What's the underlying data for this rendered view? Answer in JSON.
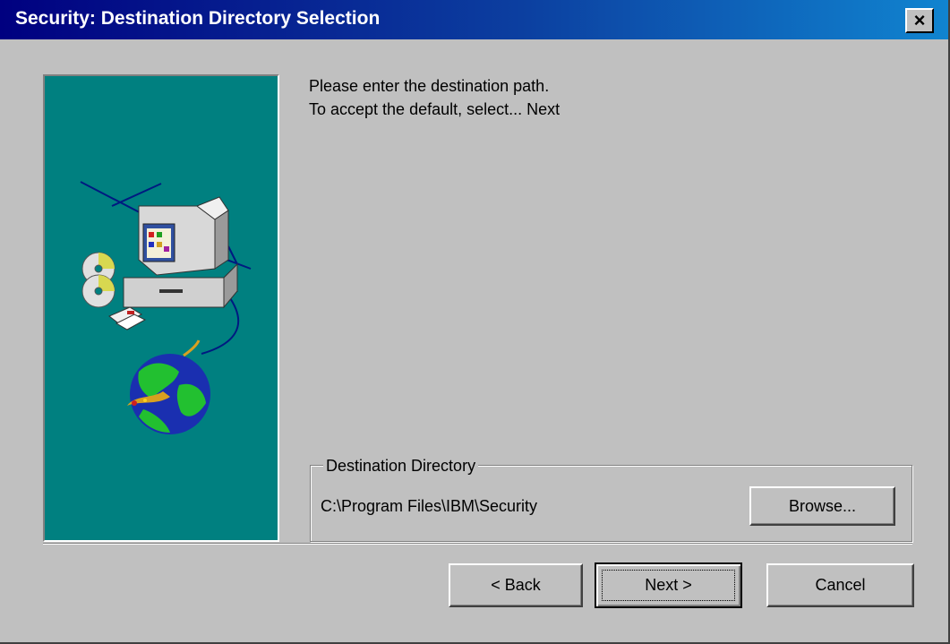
{
  "window": {
    "title": "Security: Destination Directory Selection",
    "close_glyph": "×"
  },
  "instructions": {
    "line1": "Please enter the destination path.",
    "line2": "To accept the default, select... Next"
  },
  "destination": {
    "group_label": "Destination Directory",
    "path": "C:\\Program Files\\IBM\\Security",
    "browse_label": "Browse..."
  },
  "buttons": {
    "back_label": "< Back",
    "next_label": "Next >",
    "cancel_label": "Cancel"
  },
  "colors": {
    "title_gradient_start": "#000080",
    "title_gradient_end": "#1084d0",
    "panel_teal": "#008080",
    "face": "#c0c0c0"
  },
  "illustration": {
    "icons": [
      "computer-icon",
      "cd-icon",
      "floppy-icon",
      "globe-icon"
    ]
  }
}
